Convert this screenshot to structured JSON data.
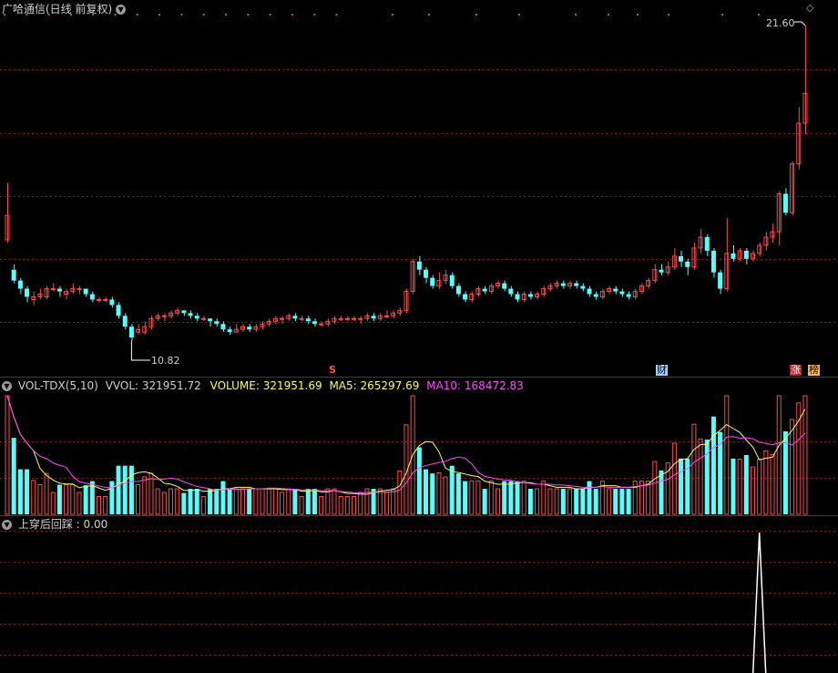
{
  "header": {
    "title": "广哈通信(日线 前复权)",
    "dropdown_icon": "chevron-down-icon"
  },
  "colors": {
    "up": "#ff4a4a",
    "down": "#54ffff",
    "grid": "#8b1a1a",
    "ma5": "#ffff4a",
    "ma10": "#ff4aff",
    "white": "#ffffff",
    "marker": "#cc33cc"
  },
  "price_panel": {
    "high_label": "21.60",
    "low_label": "10.82",
    "tags": {
      "s_tag": "S",
      "cai_tag": "财",
      "zhang_tag": "涨",
      "bang_tag": "榜"
    },
    "diamond_icon": "diamond-icon"
  },
  "volume_panel": {
    "name": "VOL-TDX(5,10)",
    "vvol": "VVOL: 321951.72",
    "volume": "VOLUME: 321951.69",
    "ma5": "MA5: 265297.69",
    "ma10": "MA10: 168472.83"
  },
  "indicator_panel": {
    "name": "上穿后回踩",
    "value": ": 0.00"
  },
  "chart_data": {
    "type": "candlestick",
    "price_range": [
      10.82,
      21.6
    ],
    "candles": [
      [
        13.7,
        14.6,
        13.6,
        15.8
      ],
      [
        12.6,
        12.2,
        12.1,
        12.8
      ],
      [
        12.2,
        11.9,
        11.7,
        12.3
      ],
      [
        11.9,
        11.6,
        11.4,
        12.0
      ],
      [
        11.5,
        11.6,
        11.3,
        11.8
      ],
      [
        11.6,
        11.7,
        11.5,
        11.9
      ],
      [
        11.6,
        11.9,
        11.5,
        12.0
      ],
      [
        11.9,
        11.9,
        11.8,
        12.1
      ],
      [
        11.9,
        11.8,
        11.6,
        12.0
      ],
      [
        11.7,
        11.8,
        11.5,
        11.9
      ],
      [
        11.8,
        11.9,
        11.7,
        12.1
      ],
      [
        11.9,
        11.9,
        11.7,
        12.0
      ],
      [
        11.9,
        11.7,
        11.6,
        11.9
      ],
      [
        11.7,
        11.5,
        11.4,
        11.8
      ],
      [
        11.5,
        11.5,
        11.4,
        11.6
      ],
      [
        11.5,
        11.5,
        11.4,
        11.6
      ],
      [
        11.5,
        11.3,
        11.2,
        11.6
      ],
      [
        11.3,
        10.9,
        10.8,
        11.4
      ],
      [
        10.9,
        10.5,
        10.4,
        11.0
      ],
      [
        10.5,
        10.1,
        10.0,
        10.6
      ],
      [
        10.3,
        10.4,
        10.2,
        10.6
      ],
      [
        10.3,
        10.5,
        10.2,
        10.7
      ],
      [
        10.5,
        10.8,
        10.4,
        10.9
      ],
      [
        10.8,
        10.9,
        10.7,
        11.0
      ],
      [
        10.9,
        10.9,
        10.7,
        11.0
      ],
      [
        10.9,
        11.0,
        10.8,
        11.1
      ],
      [
        11.0,
        11.1,
        10.9,
        11.2
      ],
      [
        11.1,
        11.0,
        10.9,
        11.1
      ],
      [
        11.0,
        10.9,
        10.8,
        11.1
      ],
      [
        10.9,
        10.8,
        10.7,
        11.0
      ],
      [
        10.8,
        10.8,
        10.7,
        10.9
      ],
      [
        10.8,
        10.7,
        10.5,
        10.8
      ],
      [
        10.7,
        10.6,
        10.5,
        10.8
      ],
      [
        10.6,
        10.4,
        10.3,
        10.7
      ],
      [
        10.4,
        10.3,
        10.2,
        10.5
      ],
      [
        10.3,
        10.4,
        10.3,
        10.6
      ],
      [
        10.4,
        10.5,
        10.3,
        10.6
      ],
      [
        10.5,
        10.4,
        10.3,
        10.6
      ],
      [
        10.4,
        10.5,
        10.3,
        10.6
      ],
      [
        10.5,
        10.6,
        10.4,
        10.7
      ],
      [
        10.6,
        10.7,
        10.5,
        10.8
      ],
      [
        10.7,
        10.8,
        10.6,
        10.9
      ],
      [
        10.8,
        10.8,
        10.6,
        10.9
      ],
      [
        10.8,
        10.9,
        10.7,
        11.0
      ],
      [
        10.9,
        10.8,
        10.7,
        11.0
      ],
      [
        10.8,
        10.8,
        10.7,
        10.9
      ],
      [
        10.8,
        10.7,
        10.6,
        10.9
      ],
      [
        10.7,
        10.6,
        10.5,
        10.8
      ],
      [
        10.6,
        10.6,
        10.5,
        10.7
      ],
      [
        10.6,
        10.7,
        10.5,
        10.8
      ],
      [
        10.7,
        10.8,
        10.6,
        10.9
      ],
      [
        10.8,
        10.8,
        10.7,
        10.9
      ],
      [
        10.8,
        10.8,
        10.7,
        10.9
      ],
      [
        10.8,
        10.8,
        10.7,
        10.9
      ],
      [
        10.8,
        10.8,
        10.6,
        10.9
      ],
      [
        10.8,
        10.9,
        10.7,
        11.0
      ],
      [
        10.9,
        10.8,
        10.7,
        11.0
      ],
      [
        10.8,
        10.9,
        10.7,
        11.0
      ],
      [
        10.9,
        10.9,
        10.8,
        11.1
      ],
      [
        10.9,
        11.0,
        10.8,
        11.1
      ],
      [
        11.0,
        11.1,
        10.9,
        11.2
      ],
      [
        11.1,
        11.8,
        11.0,
        11.9
      ],
      [
        11.8,
        12.9,
        11.7,
        13.0
      ],
      [
        12.9,
        12.6,
        12.4,
        13.1
      ],
      [
        12.6,
        12.3,
        12.1,
        12.7
      ],
      [
        12.3,
        12.0,
        11.9,
        12.4
      ],
      [
        12.0,
        12.2,
        11.9,
        12.5
      ],
      [
        12.2,
        12.4,
        12.1,
        12.6
      ],
      [
        12.4,
        12.0,
        11.9,
        12.5
      ],
      [
        12.0,
        11.7,
        11.6,
        12.1
      ],
      [
        11.7,
        11.5,
        11.4,
        11.8
      ],
      [
        11.5,
        11.7,
        11.4,
        11.8
      ],
      [
        11.7,
        11.9,
        11.6,
        12.0
      ],
      [
        11.9,
        11.8,
        11.7,
        12.0
      ],
      [
        11.8,
        12.0,
        11.7,
        12.1
      ],
      [
        12.0,
        12.1,
        11.9,
        12.2
      ],
      [
        12.1,
        11.9,
        11.8,
        12.2
      ],
      [
        11.9,
        11.7,
        11.6,
        12.0
      ],
      [
        11.7,
        11.5,
        11.4,
        11.8
      ],
      [
        11.5,
        11.7,
        11.4,
        11.8
      ],
      [
        11.7,
        11.6,
        11.5,
        11.8
      ],
      [
        11.6,
        11.7,
        11.5,
        11.8
      ],
      [
        11.7,
        11.9,
        11.6,
        12.0
      ],
      [
        11.9,
        12.0,
        11.8,
        12.1
      ],
      [
        12.0,
        12.1,
        11.9,
        12.2
      ],
      [
        12.1,
        12.0,
        11.9,
        12.2
      ],
      [
        12.0,
        12.1,
        11.9,
        12.2
      ],
      [
        12.1,
        12.0,
        11.9,
        12.2
      ],
      [
        12.0,
        11.9,
        11.8,
        12.1
      ],
      [
        11.9,
        11.7,
        11.6,
        12.0
      ],
      [
        11.7,
        11.6,
        11.5,
        11.8
      ],
      [
        11.6,
        11.8,
        11.5,
        11.9
      ],
      [
        11.8,
        11.9,
        11.7,
        12.0
      ],
      [
        11.9,
        11.8,
        11.7,
        12.0
      ],
      [
        11.8,
        11.7,
        11.6,
        11.9
      ],
      [
        11.7,
        11.6,
        11.5,
        11.8
      ],
      [
        11.6,
        11.8,
        11.5,
        11.9
      ],
      [
        11.8,
        12.0,
        11.7,
        12.1
      ],
      [
        12.0,
        12.2,
        11.9,
        12.3
      ],
      [
        12.2,
        12.6,
        12.1,
        12.8
      ],
      [
        12.6,
        12.5,
        12.4,
        12.8
      ],
      [
        12.5,
        12.7,
        12.4,
        12.9
      ],
      [
        12.7,
        13.1,
        12.6,
        13.4
      ],
      [
        13.1,
        12.9,
        12.7,
        13.3
      ],
      [
        12.9,
        12.7,
        12.4,
        13.0
      ],
      [
        12.7,
        13.4,
        12.6,
        13.6
      ],
      [
        13.4,
        13.8,
        13.2,
        14.1
      ],
      [
        13.8,
        13.3,
        13.1,
        13.9
      ],
      [
        13.3,
        12.5,
        12.3,
        13.4
      ],
      [
        12.5,
        11.9,
        11.7,
        12.6
      ],
      [
        11.9,
        13.2,
        11.8,
        14.5
      ],
      [
        13.2,
        13.0,
        12.9,
        13.5
      ],
      [
        13.0,
        13.3,
        12.9,
        13.4
      ],
      [
        13.3,
        13.0,
        12.8,
        13.4
      ],
      [
        13.0,
        13.2,
        12.9,
        13.3
      ],
      [
        13.2,
        13.5,
        13.1,
        13.6
      ],
      [
        13.5,
        13.8,
        13.3,
        14.0
      ],
      [
        13.8,
        14.0,
        13.6,
        14.3
      ],
      [
        14.0,
        15.4,
        13.5,
        15.5
      ],
      [
        15.4,
        14.7,
        14.6,
        15.6
      ],
      [
        14.7,
        16.5,
        14.6,
        16.6
      ],
      [
        16.5,
        18.0,
        16.3,
        18.6
      ],
      [
        18.0,
        19.1,
        17.6,
        21.6
      ]
    ],
    "volume": {
      "series": [
        "VOLUME",
        "MA5",
        "MA10"
      ],
      "max": 321951.69
    },
    "indicator": {
      "name": "上穿后回踩",
      "value": 0.0,
      "spike_index": 115
    }
  }
}
